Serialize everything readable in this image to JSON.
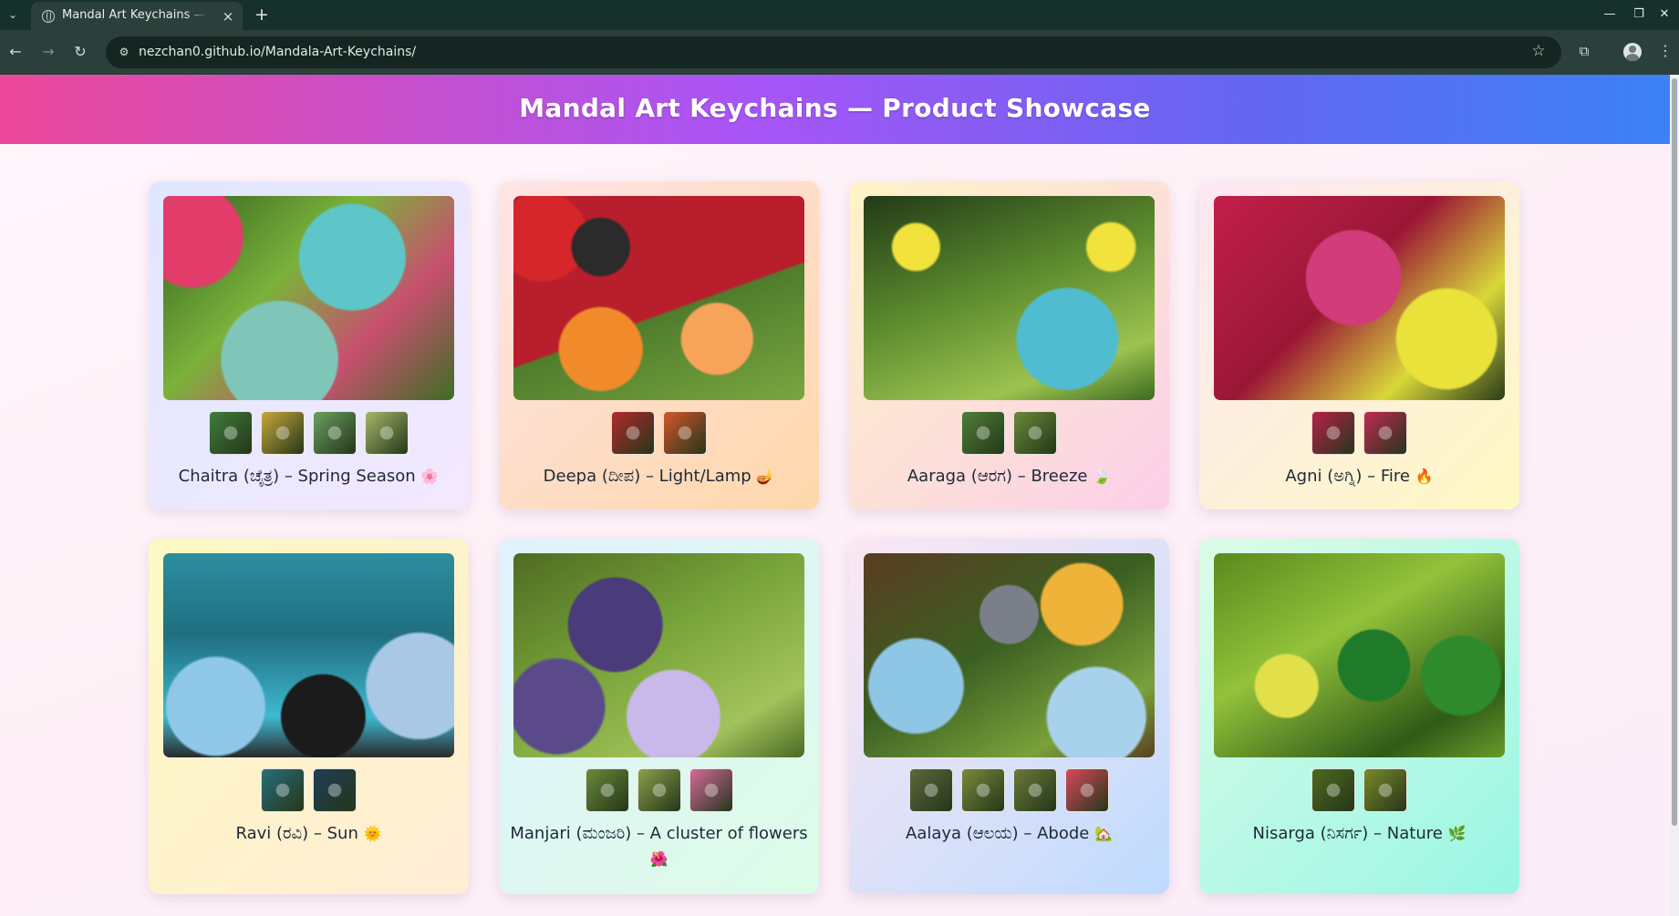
{
  "browser": {
    "tab_title": "Mandal Art Keychains —",
    "tab_close": "×",
    "new_tab": "+",
    "url": "nezchan0.github.io/Mandala-Art-Keychains/"
  },
  "page": {
    "title": "Mandal Art Keychains — Product Showcase"
  },
  "products": [
    {
      "name": "Chaitra (ಚೈತ್ರ) – Spring Season",
      "emoji": "🌸",
      "thumb_count": 4
    },
    {
      "name": "Deepa (ದೀಪ) – Light/Lamp",
      "emoji": "🪔",
      "thumb_count": 2
    },
    {
      "name": "Aaraga (ಆರಗ) – Breeze",
      "emoji": "🍃",
      "thumb_count": 2
    },
    {
      "name": "Agni (ಅಗ್ನಿ) – Fire",
      "emoji": "🔥",
      "thumb_count": 2
    },
    {
      "name": "Ravi (ರವಿ) – Sun",
      "emoji": "🌞",
      "thumb_count": 2
    },
    {
      "name": "Manjari (ಮಂಜರಿ) – A cluster of flowers",
      "emoji": "🌺",
      "thumb_count": 3
    },
    {
      "name": "Aalaya (ಆಲಯ) – Abode",
      "emoji": "🏡",
      "thumb_count": 4
    },
    {
      "name": "Nisarga (ನಿಸರ್ಗ) – Nature",
      "emoji": "🌿",
      "thumb_count": 2
    }
  ]
}
